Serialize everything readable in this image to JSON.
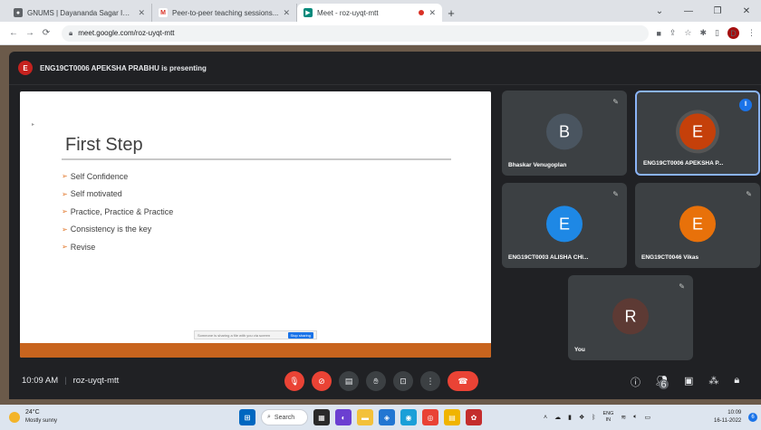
{
  "browser": {
    "tabs": [
      {
        "title": "GNUMS | Dayananda Sagar Insti...",
        "favicon": "globe-icon",
        "active": false
      },
      {
        "title": "Peer-to-peer teaching sessions...",
        "favicon": "gmail-icon",
        "active": false
      },
      {
        "title": "Meet - roz-uyqt-mtt",
        "favicon": "meet-icon",
        "active": true
      }
    ],
    "url": "meet.google.com/roz-uyqt-mtt",
    "profile_initial": "D"
  },
  "meet": {
    "presenter_initial": "E",
    "presenting_text": "ENG19CT0006 APEKSHA PRABHU is presenting",
    "slide": {
      "title": "First Step",
      "bullets": [
        "Self Confidence",
        "Self motivated",
        "Practice, Practice & Practice",
        "Consistency is the key",
        "Revise"
      ],
      "toolbar_text": "Someone is sharing a file with you via screen",
      "toolbar_button": "Stop sharing",
      "footer_color": "#c8641e"
    },
    "participants": [
      {
        "initial": "B",
        "name": "Bhaskar Venugoplan",
        "color": "#4a5560",
        "muted": true,
        "speaking": false
      },
      {
        "initial": "E",
        "name": "ENG19CT0006 APEKSHA P...",
        "color": "#c5400a",
        "muted": false,
        "speaking": true
      },
      {
        "initial": "E",
        "name": "ENG19CT0003 ALISHA CHI...",
        "color": "#1e88e5",
        "muted": true,
        "speaking": false
      },
      {
        "initial": "E",
        "name": "ENG19CT0046 Vikas",
        "color": "#e8710a",
        "muted": true,
        "speaking": false
      },
      {
        "initial": "R",
        "name": "You",
        "color": "#5d3a34",
        "muted": true,
        "speaking": false
      }
    ],
    "time": "10:09 AM",
    "meeting_code": "roz-uyqt-mtt",
    "people_count": "6"
  },
  "taskbar": {
    "weather_temp": "24°C",
    "weather_desc": "Mostly sunny",
    "search_label": "Search",
    "lang_top": "ENG",
    "lang_bottom": "IN",
    "clock_time": "10:09",
    "clock_date": "16-11-2022",
    "notification_count": "6"
  },
  "colors": {
    "meet_bg": "#202124",
    "tile_bg": "#3c4043",
    "danger": "#ea4335",
    "accent": "#1a73e8"
  }
}
